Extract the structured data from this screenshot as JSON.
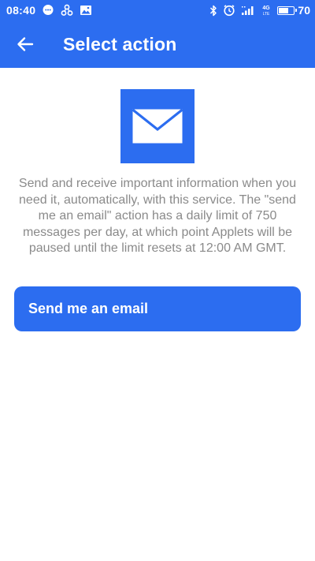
{
  "status_bar": {
    "time": "08:40",
    "network_type": "4G",
    "battery_level": "70",
    "battery_fraction": 0.7
  },
  "app_bar": {
    "title": "Select action",
    "back_icon": "arrow-left-icon"
  },
  "service": {
    "logo_icon": "email-envelope-icon",
    "description": "Send and receive important information when you need it, automatically, with this service. The \"send me an email\" action has a daily limit of 750 messages per day, at which point Applets will be paused until the limit resets at 12:00 AM GMT."
  },
  "actions": [
    {
      "label": "Send me an email"
    }
  ],
  "colors": {
    "brand_blue": "#2c6df0",
    "text_gray": "#8a8a8a",
    "background": "#ffffff"
  }
}
